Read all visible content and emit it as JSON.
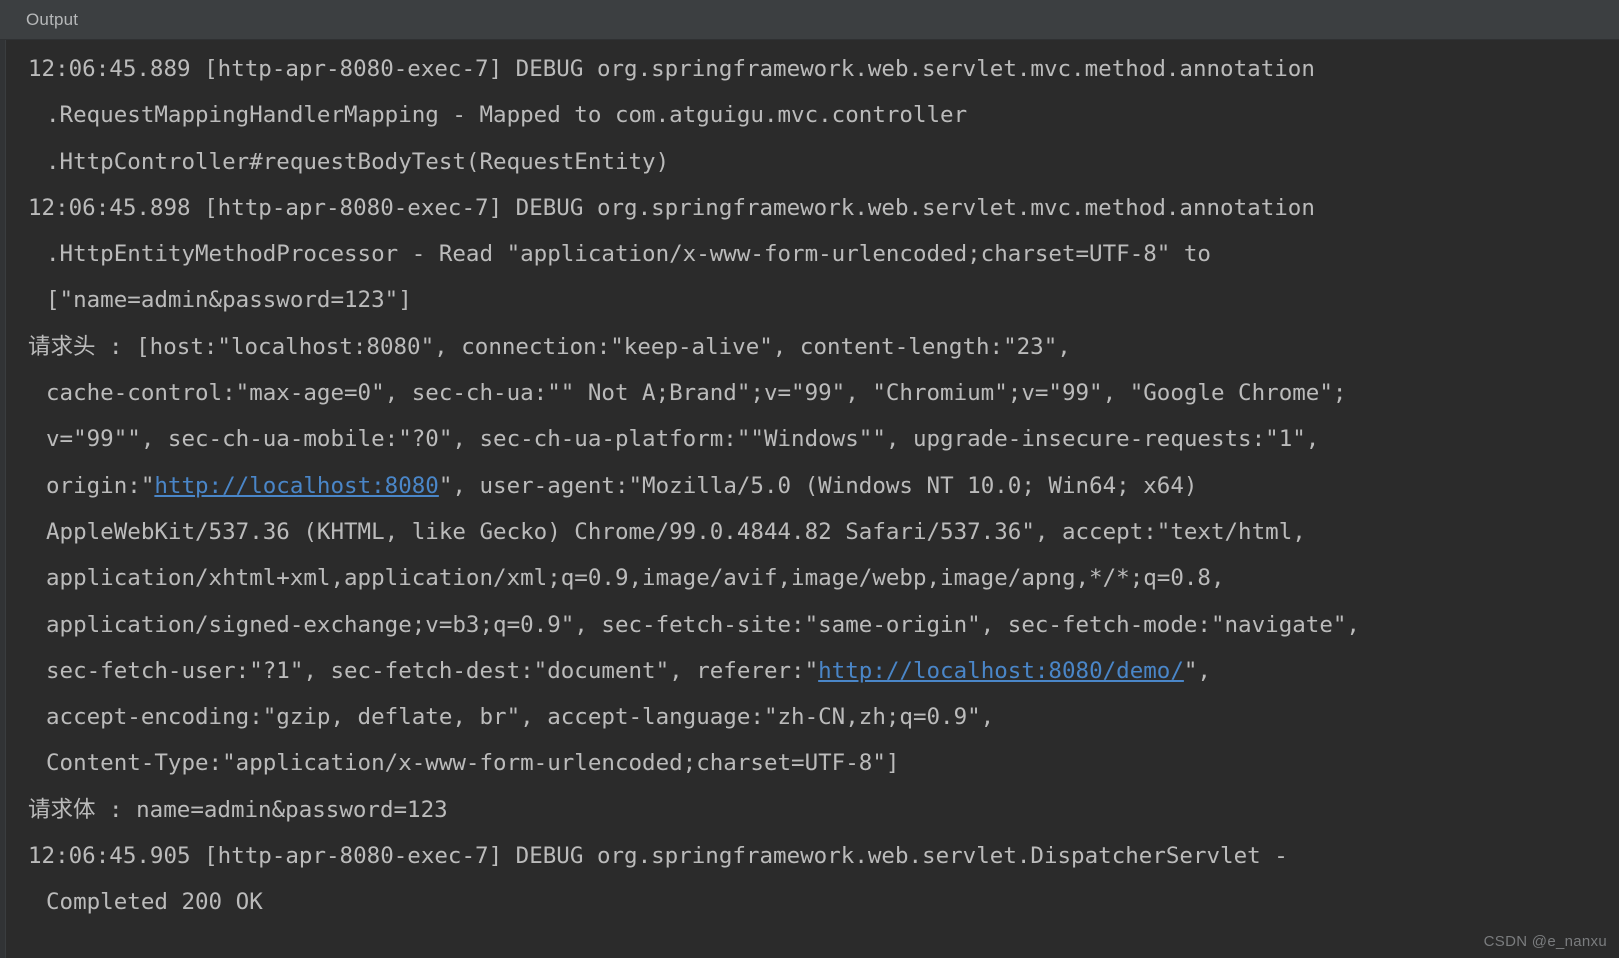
{
  "window": {
    "tool_tab_label": "Output",
    "background_color": "#2b2b2b",
    "header_color": "#3c3f41",
    "text_color": "#bbbbbb",
    "link_color": "#4a86c8"
  },
  "console": {
    "lines": [
      {
        "id": "line-1",
        "indent": "none",
        "segments": [
          {
            "type": "text",
            "value": "12:06:45.889 [http-apr-8080-exec-7] DEBUG org.springframework.web.servlet.mvc.method.annotation"
          }
        ]
      },
      {
        "id": "line-2",
        "indent": "cont",
        "segments": [
          {
            "type": "text",
            "value": ".RequestMappingHandlerMapping - Mapped to com.atguigu.mvc.controller"
          }
        ]
      },
      {
        "id": "line-3",
        "indent": "cont",
        "segments": [
          {
            "type": "text",
            "value": ".HttpController#requestBodyTest(RequestEntity)"
          }
        ]
      },
      {
        "id": "line-4",
        "indent": "none",
        "segments": [
          {
            "type": "text",
            "value": "12:06:45.898 [http-apr-8080-exec-7] DEBUG org.springframework.web.servlet.mvc.method.annotation"
          }
        ]
      },
      {
        "id": "line-5",
        "indent": "cont",
        "segments": [
          {
            "type": "text",
            "value": ".HttpEntityMethodProcessor - Read \"application/x-www-form-urlencoded;charset=UTF-8\" to"
          }
        ]
      },
      {
        "id": "line-6",
        "indent": "cont",
        "segments": [
          {
            "type": "text",
            "value": "[\"name=admin&password=123\"]"
          }
        ]
      },
      {
        "id": "line-7",
        "indent": "none",
        "segments": [
          {
            "type": "text",
            "value": "请求头 : [host:\"localhost:8080\", connection:\"keep-alive\", content-length:\"23\","
          }
        ]
      },
      {
        "id": "line-8",
        "indent": "cont",
        "segments": [
          {
            "type": "text",
            "value": "cache-control:\"max-age=0\", sec-ch-ua:\"\" Not A;Brand\";v=\"99\", \"Chromium\";v=\"99\", \"Google Chrome\";"
          }
        ]
      },
      {
        "id": "line-9",
        "indent": "cont",
        "segments": [
          {
            "type": "text",
            "value": "v=\"99\"\", sec-ch-ua-mobile:\"?0\", sec-ch-ua-platform:\"\"Windows\"\", upgrade-insecure-requests:\"1\","
          }
        ]
      },
      {
        "id": "line-10",
        "indent": "cont",
        "segments": [
          {
            "type": "text",
            "value": "origin:\""
          },
          {
            "type": "link",
            "value": "http://localhost:8080"
          },
          {
            "type": "text",
            "value": "\", user-agent:\"Mozilla/5.0 (Windows NT 10.0; Win64; x64)"
          }
        ]
      },
      {
        "id": "line-11",
        "indent": "cont",
        "segments": [
          {
            "type": "text",
            "value": "AppleWebKit/537.36 (KHTML, like Gecko) Chrome/99.0.4844.82 Safari/537.36\", accept:\"text/html,"
          }
        ]
      },
      {
        "id": "line-12",
        "indent": "cont",
        "segments": [
          {
            "type": "text",
            "value": "application/xhtml+xml,application/xml;q=0.9,image/avif,image/webp,image/apng,*/*;q=0.8,"
          }
        ]
      },
      {
        "id": "line-13",
        "indent": "cont",
        "segments": [
          {
            "type": "text",
            "value": "application/signed-exchange;v=b3;q=0.9\", sec-fetch-site:\"same-origin\", sec-fetch-mode:\"navigate\","
          }
        ]
      },
      {
        "id": "line-14",
        "indent": "cont",
        "segments": [
          {
            "type": "text",
            "value": "sec-fetch-user:\"?1\", sec-fetch-dest:\"document\", referer:\""
          },
          {
            "type": "link",
            "value": "http://localhost:8080/demo/"
          },
          {
            "type": "text",
            "value": "\","
          }
        ]
      },
      {
        "id": "line-15",
        "indent": "cont",
        "segments": [
          {
            "type": "text",
            "value": "accept-encoding:\"gzip, deflate, br\", accept-language:\"zh-CN,zh;q=0.9\","
          }
        ]
      },
      {
        "id": "line-16",
        "indent": "cont",
        "segments": [
          {
            "type": "text",
            "value": "Content-Type:\"application/x-www-form-urlencoded;charset=UTF-8\"]"
          }
        ]
      },
      {
        "id": "line-17",
        "indent": "none",
        "segments": [
          {
            "type": "text",
            "value": "请求体 : name=admin&password=123"
          }
        ]
      },
      {
        "id": "line-18",
        "indent": "none",
        "segments": [
          {
            "type": "text",
            "value": "12:06:45.905 [http-apr-8080-exec-7] DEBUG org.springframework.web.servlet.DispatcherServlet -"
          }
        ]
      },
      {
        "id": "line-19",
        "indent": "cont",
        "segments": [
          {
            "type": "text",
            "value": "Completed 200 OK"
          }
        ]
      }
    ]
  },
  "watermark": {
    "text": "CSDN @e_nanxu"
  }
}
